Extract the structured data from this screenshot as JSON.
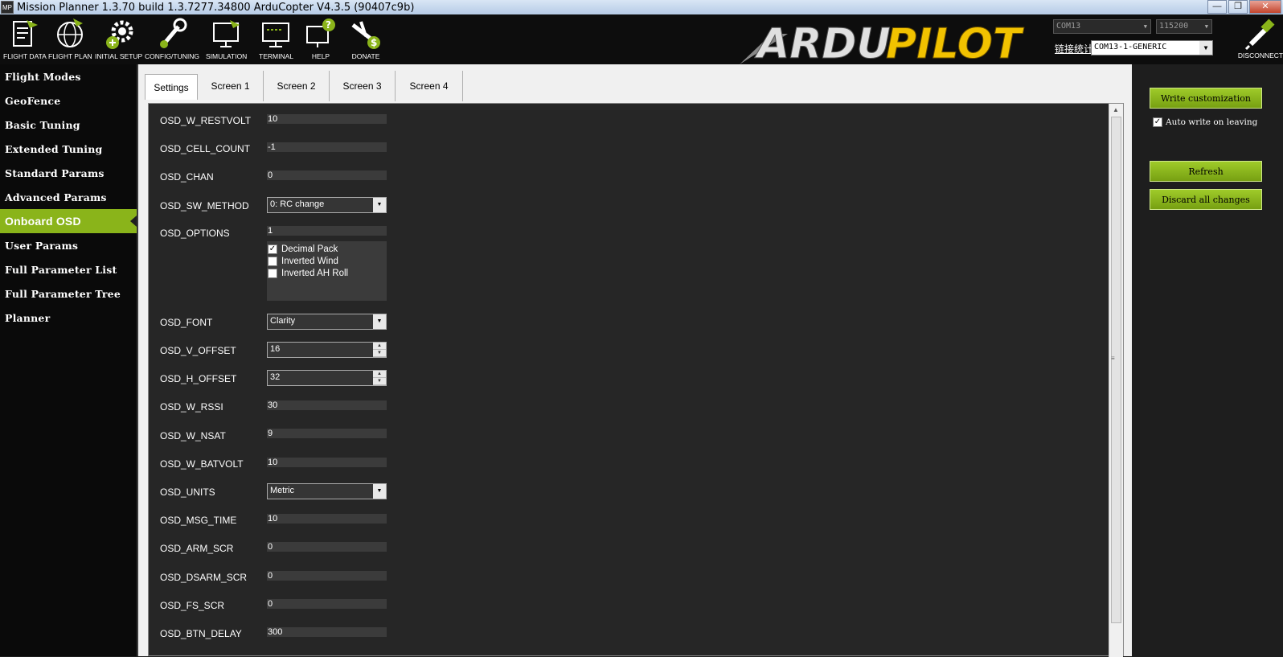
{
  "window": {
    "title": "Mission Planner 1.3.70 build 1.3.7277.34800 ArduCopter V4.3.5 (90407c9b)",
    "app_icon": "MP"
  },
  "toolbar": {
    "items": [
      {
        "label": "FLIGHT DATA",
        "icon": "flight-data-icon"
      },
      {
        "label": "FLIGHT PLAN",
        "icon": "flight-plan-icon"
      },
      {
        "label": "INITIAL SETUP",
        "icon": "initial-setup-icon"
      },
      {
        "label": "CONFIG/TUNING",
        "icon": "config-tuning-icon"
      },
      {
        "label": "SIMULATION",
        "icon": "simulation-icon"
      },
      {
        "label": "TERMINAL",
        "icon": "terminal-icon"
      },
      {
        "label": "HELP",
        "icon": "help-icon"
      },
      {
        "label": "DONATE",
        "icon": "donate-icon"
      }
    ],
    "logo_text_a": "ARDU",
    "logo_text_b": "PILOT",
    "port": "COM13",
    "baud": "115200",
    "link_stats": "链接统计",
    "connection": "COM13-1-GENERIC",
    "disconnect_label": "DISCONNECT"
  },
  "sidebar": {
    "items": [
      {
        "label": "Flight Modes"
      },
      {
        "label": "GeoFence"
      },
      {
        "label": "Basic Tuning"
      },
      {
        "label": "Extended Tuning"
      },
      {
        "label": "Standard Params"
      },
      {
        "label": "Advanced Params"
      },
      {
        "label": "Onboard OSD",
        "active": true
      },
      {
        "label": "User Params"
      },
      {
        "label": "Full Parameter List"
      },
      {
        "label": "Full Parameter Tree"
      },
      {
        "label": "Planner"
      }
    ]
  },
  "tabs": [
    "Settings",
    "Screen 1",
    "Screen 2",
    "Screen 3",
    "Screen 4"
  ],
  "params": {
    "restvolt": {
      "name": "OSD_W_RESTVOLT",
      "value": "10"
    },
    "cell_count": {
      "name": "OSD_CELL_COUNT",
      "value": "-1"
    },
    "chan": {
      "name": "OSD_CHAN",
      "value": "0"
    },
    "sw_method": {
      "name": "OSD_SW_METHOD",
      "value": "0: RC change"
    },
    "options": {
      "name": "OSD_OPTIONS",
      "value": "1",
      "flags": [
        {
          "label": "Decimal Pack",
          "checked": true
        },
        {
          "label": "Inverted Wind",
          "checked": false
        },
        {
          "label": "Inverted AH Roll",
          "checked": false
        }
      ]
    },
    "font": {
      "name": "OSD_FONT",
      "value": "Clarity"
    },
    "v_offset": {
      "name": "OSD_V_OFFSET",
      "value": "16"
    },
    "h_offset": {
      "name": "OSD_H_OFFSET",
      "value": "32"
    },
    "rssi": {
      "name": "OSD_W_RSSI",
      "value": "30"
    },
    "nsat": {
      "name": "OSD_W_NSAT",
      "value": "9"
    },
    "batvolt": {
      "name": "OSD_W_BATVOLT",
      "value": "10"
    },
    "units": {
      "name": "OSD_UNITS",
      "value": "Metric"
    },
    "msg_time": {
      "name": "OSD_MSG_TIME",
      "value": "10"
    },
    "arm_scr": {
      "name": "OSD_ARM_SCR",
      "value": "0"
    },
    "dsarm_scr": {
      "name": "OSD_DSARM_SCR",
      "value": "0"
    },
    "fs_scr": {
      "name": "OSD_FS_SCR",
      "value": "0"
    },
    "btn_delay": {
      "name": "OSD_BTN_DELAY",
      "value": "300"
    }
  },
  "actions": {
    "write": "Write customization",
    "auto_write": "Auto write on leaving",
    "auto_write_checked": true,
    "refresh": "Refresh",
    "discard": "Discard all changes"
  },
  "colors": {
    "accent": "#8ab41a",
    "toolbar_bg": "#0d0d0d",
    "panel_bg": "#262626"
  }
}
